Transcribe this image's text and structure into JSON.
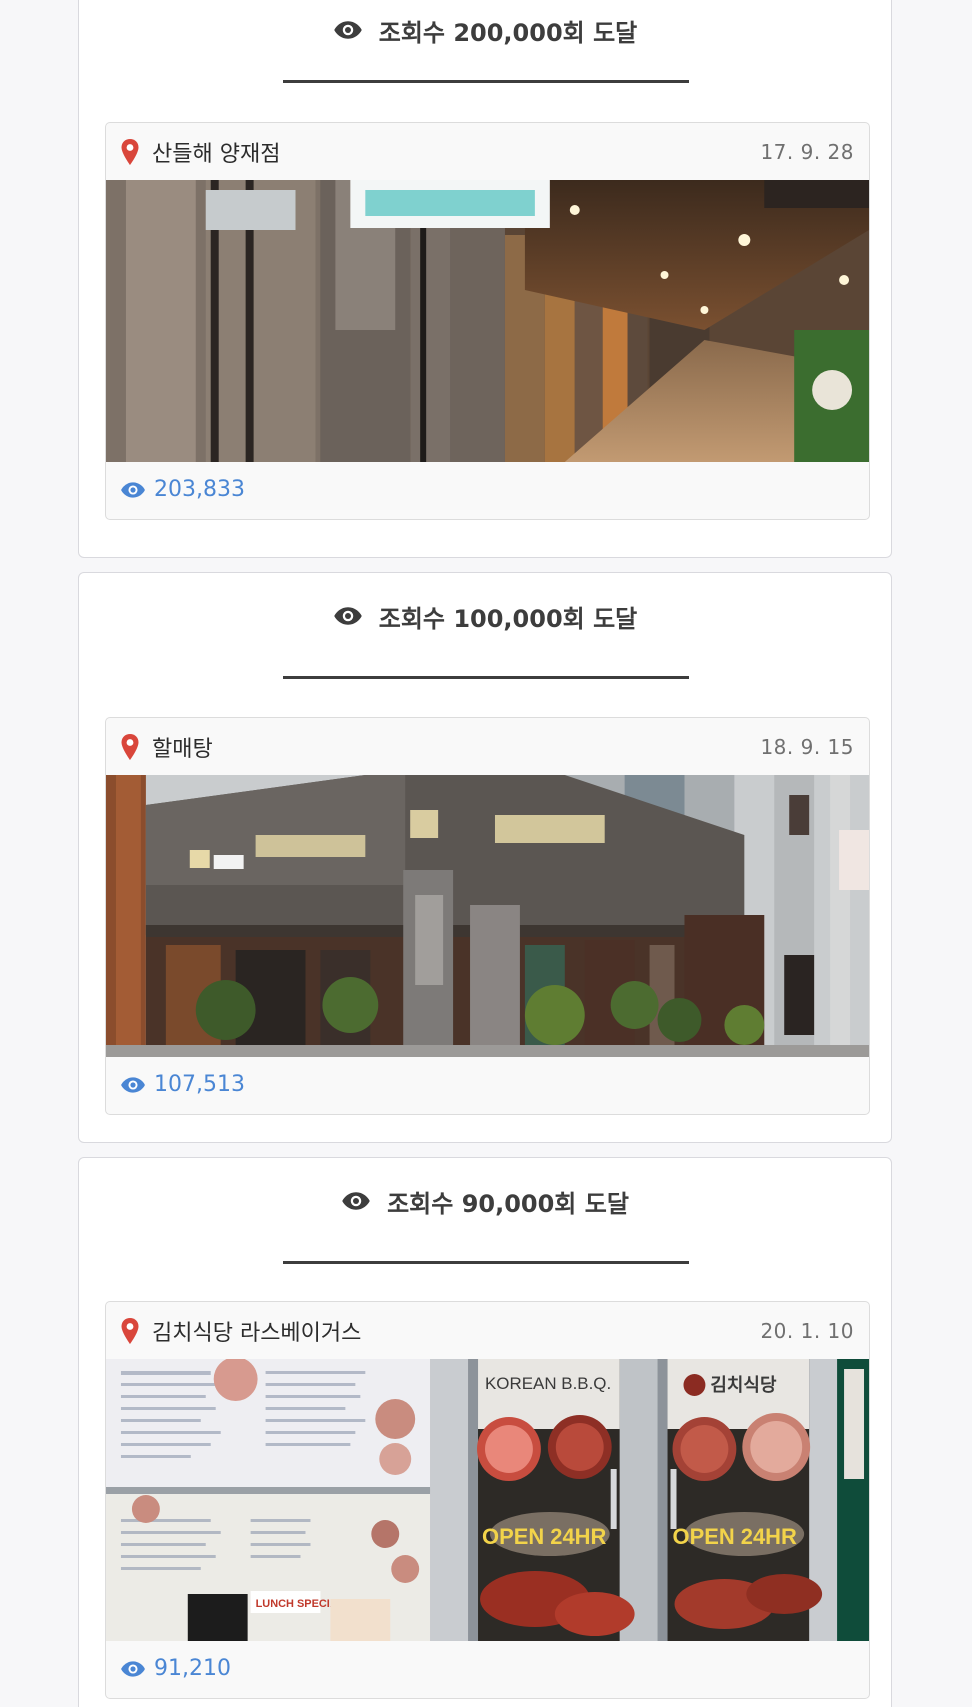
{
  "colors": {
    "heading": "#3d3d3d",
    "pin": "#d9463b",
    "view_count": "#4a86d4",
    "date": "#707070"
  },
  "icons": {
    "heading_icon": "eye-icon",
    "location_icon": "map-pin-icon",
    "views_icon": "eye-icon"
  },
  "milestones": [
    {
      "heading": "조회수 200,000회 도달",
      "post": {
        "name": "산들해 양재점",
        "date": "17. 9. 28",
        "views": "203,833"
      }
    },
    {
      "heading": "조회수 100,000회 도달",
      "post": {
        "name": "할매탕",
        "date": "18. 9. 15",
        "views": "107,513"
      }
    },
    {
      "heading": "조회수 90,000회 도달",
      "post": {
        "name": "김치식당 라스베이거스",
        "date": "20. 1. 10",
        "views": "91,210",
        "image_text": {
          "sign_left": "KOREAN B.B.Q.",
          "sign_right": "김치식당",
          "banner_left": "OPEN 24HR",
          "banner_right": "OPEN 24HR",
          "menu_label": "LUNCH SPECIAL"
        }
      }
    }
  ]
}
